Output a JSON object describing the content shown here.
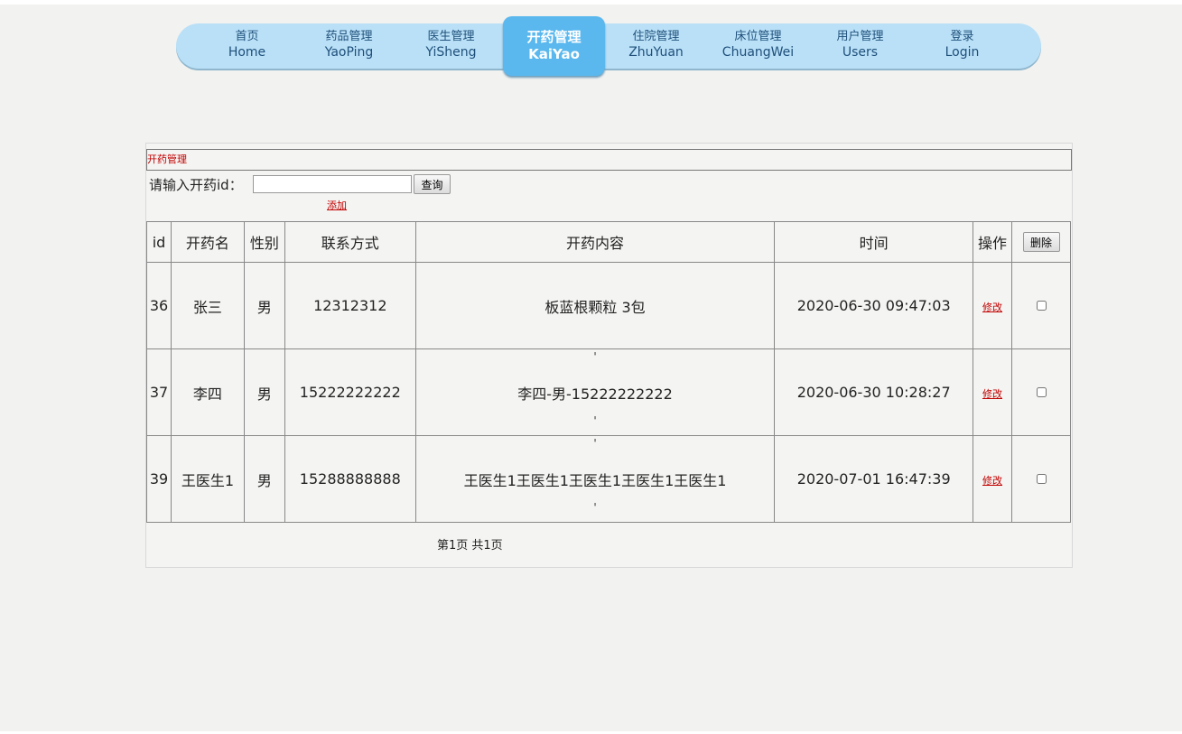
{
  "nav": {
    "items": [
      {
        "cn": "首页",
        "en": "Home"
      },
      {
        "cn": "药品管理",
        "en": "YaoPing"
      },
      {
        "cn": "医生管理",
        "en": "YiSheng"
      },
      {
        "cn": "开药管理",
        "en": "KaiYao"
      },
      {
        "cn": "住院管理",
        "en": "ZhuYuan"
      },
      {
        "cn": "床位管理",
        "en": "ChuangWei"
      },
      {
        "cn": "用户管理",
        "en": "Users"
      },
      {
        "cn": "登录",
        "en": "Login"
      }
    ],
    "active_index": 3
  },
  "panel": {
    "title": "开药管理",
    "search_label": "请输入开药id：",
    "search_value": "",
    "query_button": "查询",
    "add_link": "添加"
  },
  "table": {
    "headers": {
      "id": "id",
      "name": "开药名",
      "gender": "性别",
      "phone": "联系方式",
      "content": "开药内容",
      "time": "时间",
      "action": "操作",
      "delete_button": "删除"
    },
    "rows": [
      {
        "id": "36",
        "name": "张三",
        "gender": "男",
        "phone": "12312312",
        "content": "板蓝根颗粒 3包",
        "time": "2020-06-30 09:47:03",
        "edit": "修改",
        "checked": false
      },
      {
        "id": "37",
        "name": "李四",
        "gender": "男",
        "phone": "15222222222",
        "content": "李四-男-15222222222",
        "time": "2020-06-30 10:28:27",
        "edit": "修改",
        "checked": false
      },
      {
        "id": "39",
        "name": "王医生1",
        "gender": "男",
        "phone": "15288888888",
        "content": "王医生1王医生1王医生1王医生1王医生1",
        "time": "2020-07-01 16:47:39",
        "edit": "修改",
        "checked": false
      }
    ],
    "quote_mark": "'"
  },
  "pager": {
    "text": "第1页  共1页"
  }
}
